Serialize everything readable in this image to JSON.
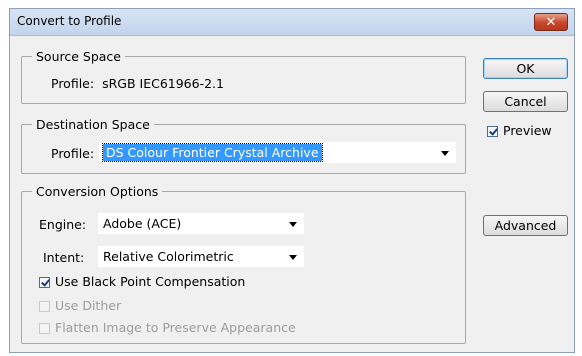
{
  "window": {
    "title": "Convert to Profile",
    "close_label": "✕"
  },
  "source_space": {
    "legend": "Source Space",
    "profile_label": "Profile:",
    "profile_value": "sRGB IEC61966-2.1"
  },
  "destination_space": {
    "legend": "Destination Space",
    "profile_label": "Profile:",
    "profile_value": "DS Colour  Frontier Crystal Archive"
  },
  "conversion_options": {
    "legend": "Conversion Options",
    "engine_label": "Engine:",
    "engine_value": "Adobe (ACE)",
    "intent_label": "Intent:",
    "intent_value": "Relative Colorimetric",
    "black_point_label": "Use Black Point Compensation",
    "black_point_checked": true,
    "dither_label": "Use Dither",
    "dither_checked": false,
    "dither_enabled": false,
    "flatten_label": "Flatten Image to Preserve Appearance",
    "flatten_checked": false,
    "flatten_enabled": false
  },
  "buttons": {
    "ok": "OK",
    "cancel": "Cancel",
    "advanced": "Advanced"
  },
  "preview": {
    "label": "Preview",
    "checked": true
  },
  "colors": {
    "selection": "#3399ff",
    "title_bar": "#c8d8ef",
    "close_button": "#c8452a"
  }
}
